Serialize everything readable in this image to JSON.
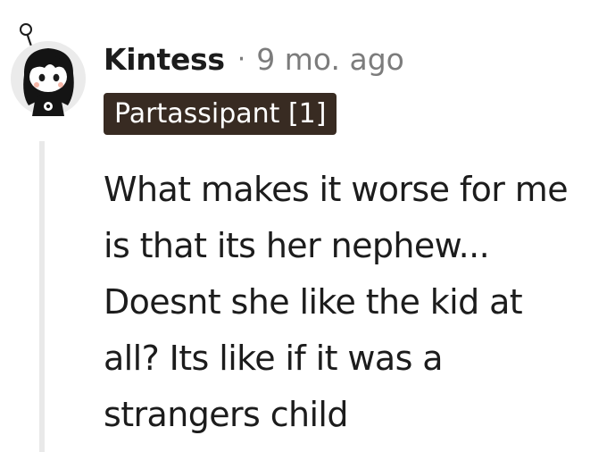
{
  "comment": {
    "author": "Kintess",
    "separator": "·",
    "timestamp": "9 mo. ago",
    "flair": "Partassipant [1]",
    "body_lines": [
      "What makes it worse for me",
      "is that its her nephew...",
      "Doesnt she like the kid at",
      "all? Its like if it was a",
      "strangers child"
    ]
  },
  "colors": {
    "flair_background": "#382b22",
    "flair_text": "#ffffff",
    "meta_text": "#7c7c7c",
    "body_text": "#1c1c1c",
    "thread_line": "#e9e9e9"
  },
  "icons": {
    "avatar": "snoo-avatar-icon"
  }
}
